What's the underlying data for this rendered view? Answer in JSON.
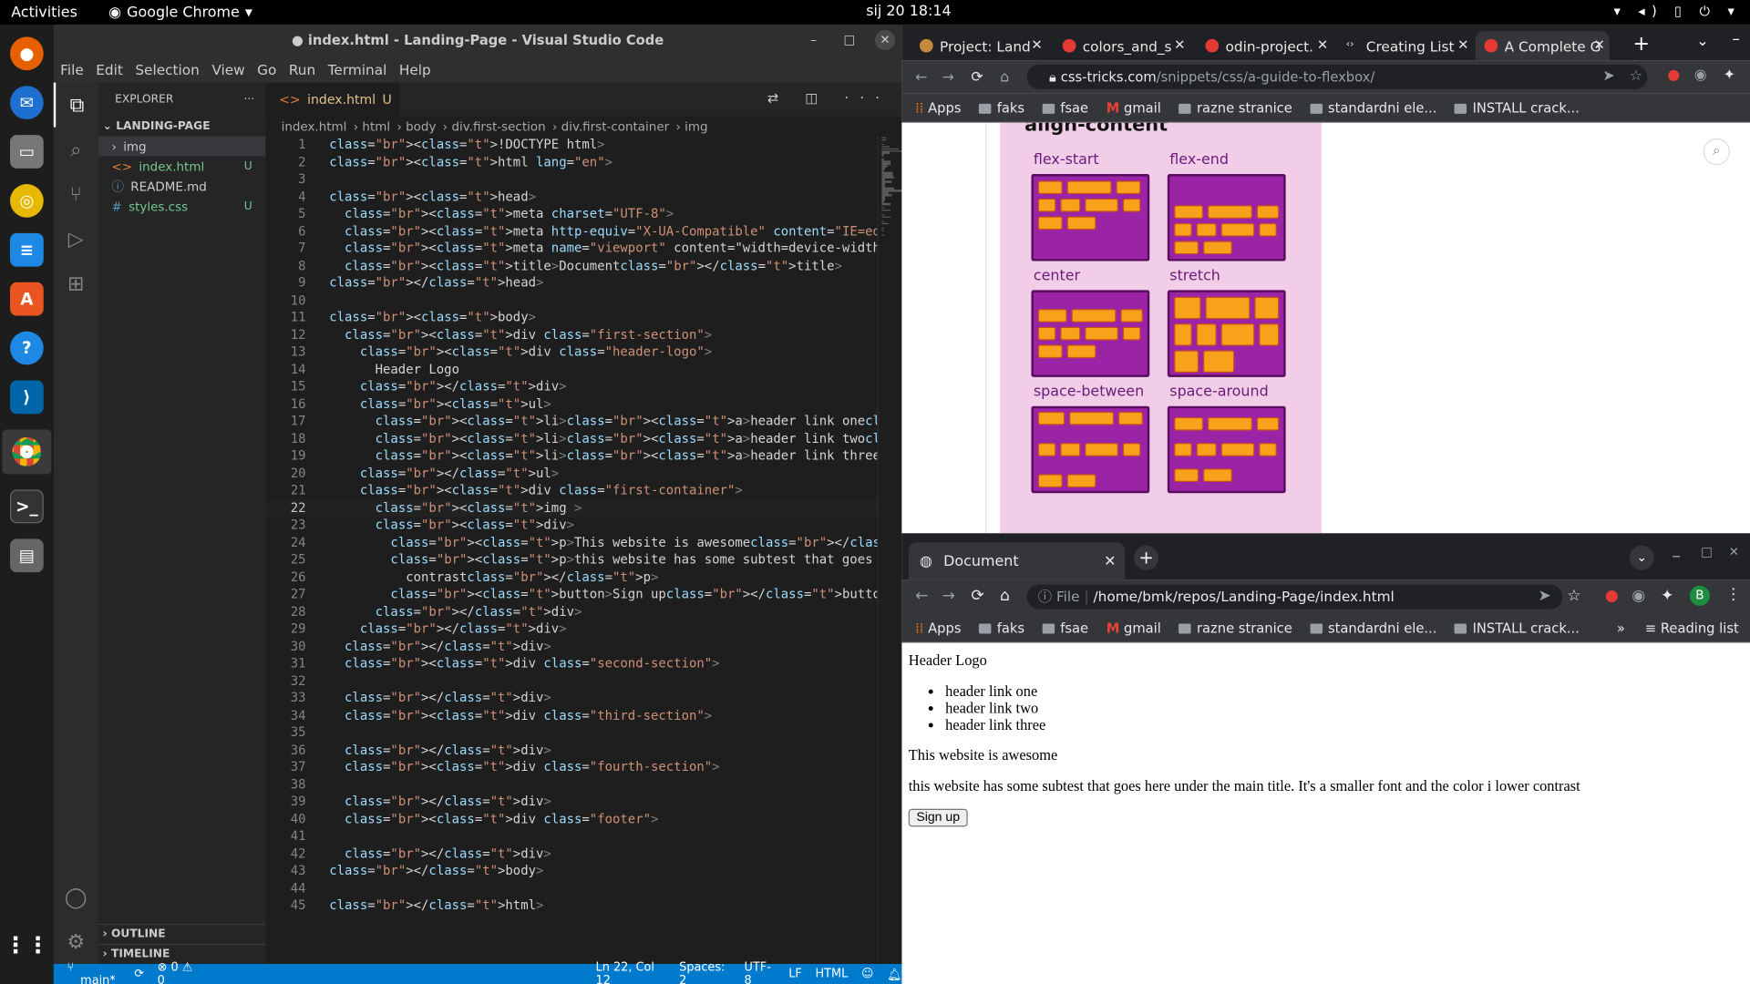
{
  "topbar": {
    "activities": "Activities",
    "app": "Google Chrome",
    "clock": "sij 20  18:14"
  },
  "vscode": {
    "title": "● index.html - Landing-Page - Visual Studio Code",
    "menu": [
      "File",
      "Edit",
      "Selection",
      "View",
      "Go",
      "Run",
      "Terminal",
      "Help"
    ],
    "explorer": {
      "header": "EXPLORER",
      "project": "LANDING-PAGE",
      "files": [
        {
          "name": "img",
          "badge": "",
          "prefix": "›"
        },
        {
          "name": "index.html",
          "badge": "U",
          "prefix": "<>"
        },
        {
          "name": "README.md",
          "badge": "",
          "prefix": "ⓘ"
        },
        {
          "name": "styles.css",
          "badge": "U",
          "prefix": "#"
        }
      ],
      "outline": "OUTLINE",
      "timeline": "TIMELINE"
    },
    "tab": {
      "name": "index.html",
      "badge": "U"
    },
    "breadcrumbs": [
      "index.html",
      "html",
      "body",
      "div.first-section",
      "div.first-container",
      "img"
    ],
    "code": [
      "<!DOCTYPE html>",
      "<html lang=\"en\">",
      "",
      "<head>",
      "  <meta charset=\"UTF-8\">",
      "  <meta http-equiv=\"X-UA-Compatible\" content=\"IE=edge\">",
      "  <meta name=\"viewport\" content=\"width=device-width, initial-sca",
      "  <title>Document</title>",
      "</head>",
      "",
      "<body>",
      "  <div class=\"first-section\">",
      "    <div class=\"header-logo\">",
      "      Header Logo",
      "    </div>",
      "    <ul>",
      "      <li><a>header link one</a></li>",
      "      <li><a>header link two</a></li>",
      "      <li><a>header link three</a></li>",
      "    </ul>",
      "    <div class=\"first-container\">",
      "      <img >",
      "      <div>",
      "        <p>This website is awesome</p>",
      "        <p>this website has some subtest that goes here under th",
      "          contrast</p>",
      "        <button>Sign up</button>",
      "      </div>",
      "    </div>",
      "  </div>",
      "  <div class=\"second-section\">",
      "",
      "  </div>",
      "  <div class=\"third-section\">",
      "",
      "  </div>",
      "  <div class=\"fourth-section\">",
      "",
      "  </div>",
      "  <div class=\"footer\">",
      "",
      "  </div>",
      "</body>",
      "",
      "</html>"
    ],
    "status": {
      "branch": "main*",
      "problems": "⊗ 0 ⚠ 0",
      "position": "Ln 22, Col 12",
      "spaces": "Spaces: 2",
      "encoding": "UTF-8",
      "eol": "LF",
      "lang": "HTML"
    }
  },
  "chrome_top": {
    "tabs": [
      "Project: Land",
      "colors_and_s",
      "odin-project.",
      "Creating List",
      "A Complete G"
    ],
    "url_host": "css-tricks.com",
    "url_path": "/snippets/css/a-guide-to-flexbox/",
    "bookmarks": [
      "Apps",
      "faks",
      "fsae",
      "gmail",
      "razne stranice",
      "standardni ele...",
      "INSTALL crack..."
    ],
    "figure": {
      "title": "align-content",
      "labels": [
        "flex-start",
        "flex-end",
        "center",
        "stretch",
        "space-between",
        "space-around"
      ]
    }
  },
  "chrome_bottom": {
    "tab": "Document",
    "file_label": "File",
    "url": "/home/bmk/repos/Landing-Page/index.html",
    "bookmarks": [
      "Apps",
      "faks",
      "fsae",
      "gmail",
      "razne stranice",
      "standardni ele...",
      "INSTALL crack..."
    ],
    "reading_list": "Reading list",
    "avatar": "B",
    "page": {
      "logo": "Header Logo",
      "links": [
        "header link one",
        "header link two",
        "header link three"
      ],
      "title": "This website is awesome",
      "subtext": "this website has some subtest that goes here under the main title. It's a smaller font and the color i lower contrast",
      "button": "Sign up"
    }
  }
}
